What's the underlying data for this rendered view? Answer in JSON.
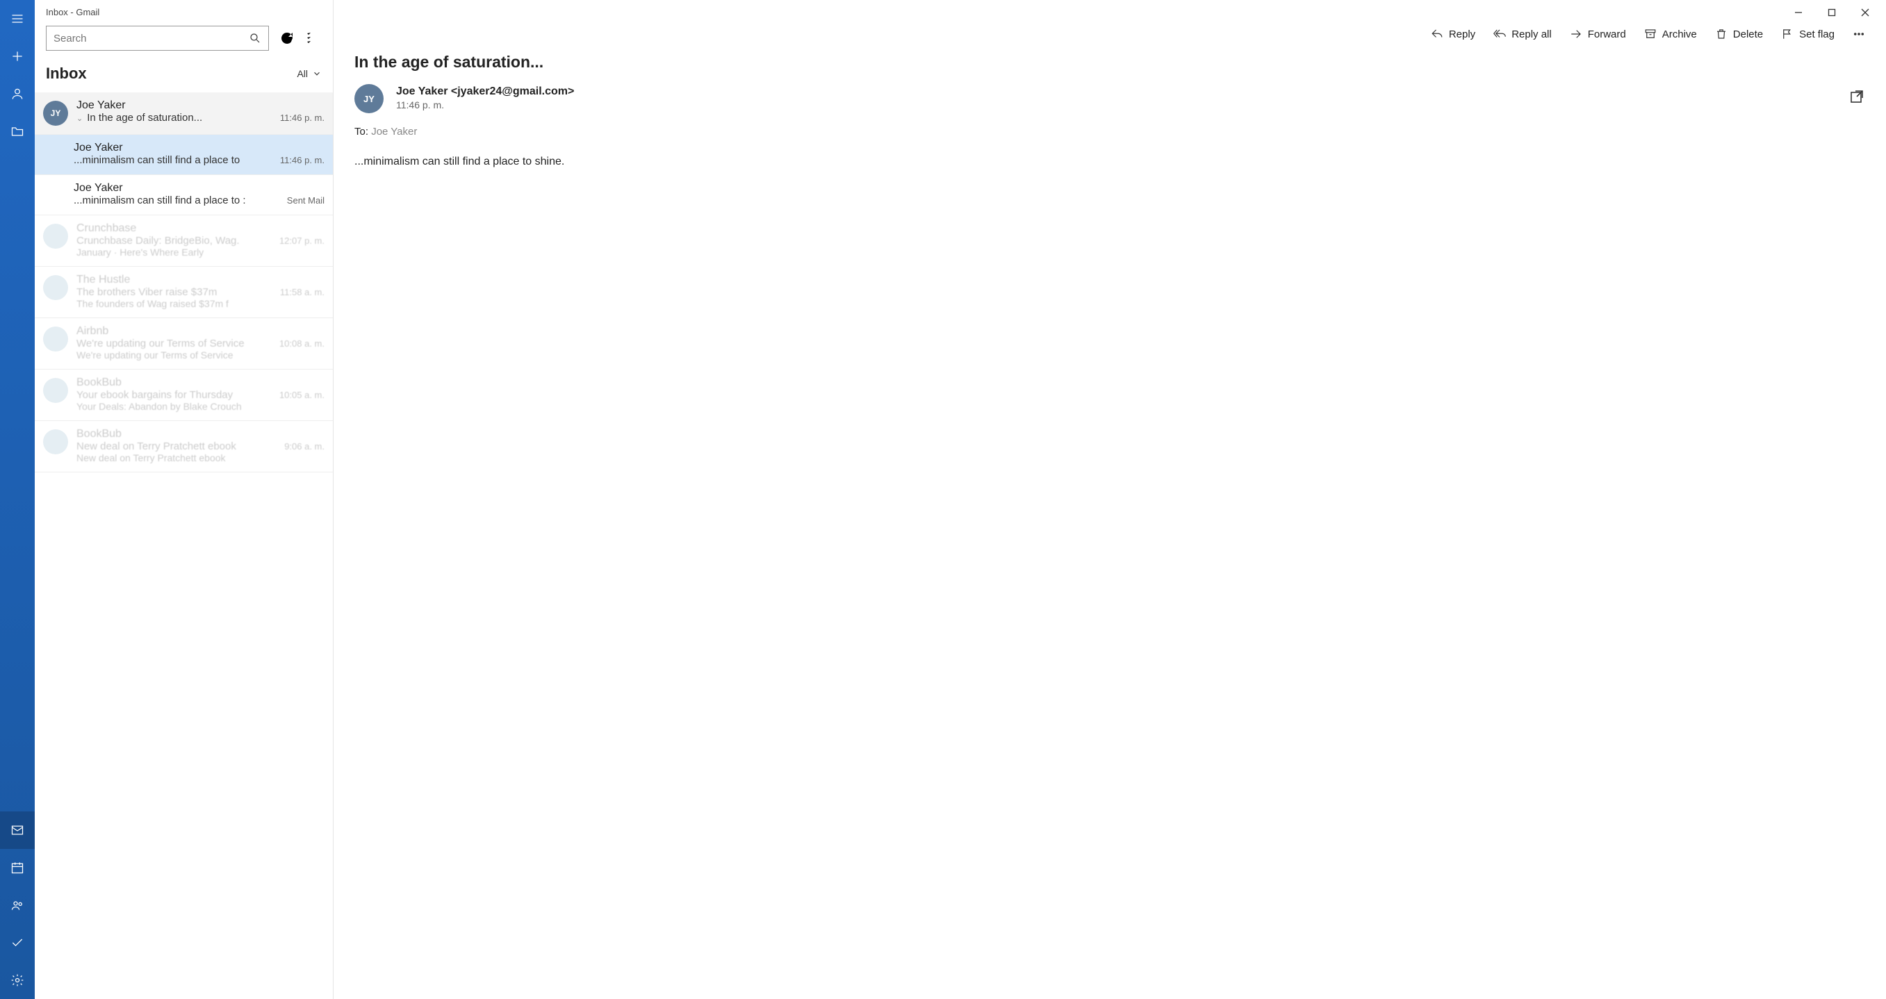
{
  "window_title": "Inbox - Gmail",
  "search_placeholder": "Search",
  "folder_name": "Inbox",
  "filter_label": "All",
  "toolbar": {
    "reply": "Reply",
    "reply_all": "Reply all",
    "forward": "Forward",
    "archive": "Archive",
    "delete": "Delete",
    "set_flag": "Set flag"
  },
  "messages": [
    {
      "sender": "Joe Yaker",
      "subject": "In the age of saturation...",
      "time": "11:46 p. m.",
      "initials": "JY",
      "threadhead": true
    },
    {
      "sender": "Joe Yaker",
      "subject": "...minimalism can still find a place to",
      "time": "11:46 p. m.",
      "child": true,
      "selected": true
    },
    {
      "sender": "Joe Yaker",
      "subject": "...minimalism can still find a place to :",
      "time": "Sent Mail",
      "child": true
    }
  ],
  "ghost_messages": [
    {
      "sender": "Crunchbase",
      "subject": "Crunchbase Daily: BridgeBio, Wag.",
      "preview": "January  ·  Here's Where Early",
      "time": "12:07 p. m."
    },
    {
      "sender": "The Hustle",
      "subject": "The brothers Viber raise $37m",
      "preview": "The founders of Wag raised $37m f",
      "time": "11:58 a. m."
    },
    {
      "sender": "Airbnb",
      "subject": "We're updating our Terms of Service",
      "preview": "We're updating our Terms of Service",
      "time": "10:08 a. m."
    },
    {
      "sender": "BookBub",
      "subject": "Your ebook bargains for Thursday",
      "preview": "Your Deals: Abandon by Blake Crouch",
      "time": "10:05 a. m."
    },
    {
      "sender": "BookBub",
      "subject": "New deal on Terry Pratchett ebook",
      "preview": "New deal on Terry Pratchett ebook",
      "time": "9:06 a. m."
    }
  ],
  "open_message": {
    "subject": "In the age of saturation...",
    "from_display": "Joe Yaker <jyaker24@gmail.com>",
    "initials": "JY",
    "time": "11:46 p. m.",
    "to_label": "To:",
    "to_value": "Joe Yaker",
    "body": "...minimalism can still find a place to shine."
  }
}
